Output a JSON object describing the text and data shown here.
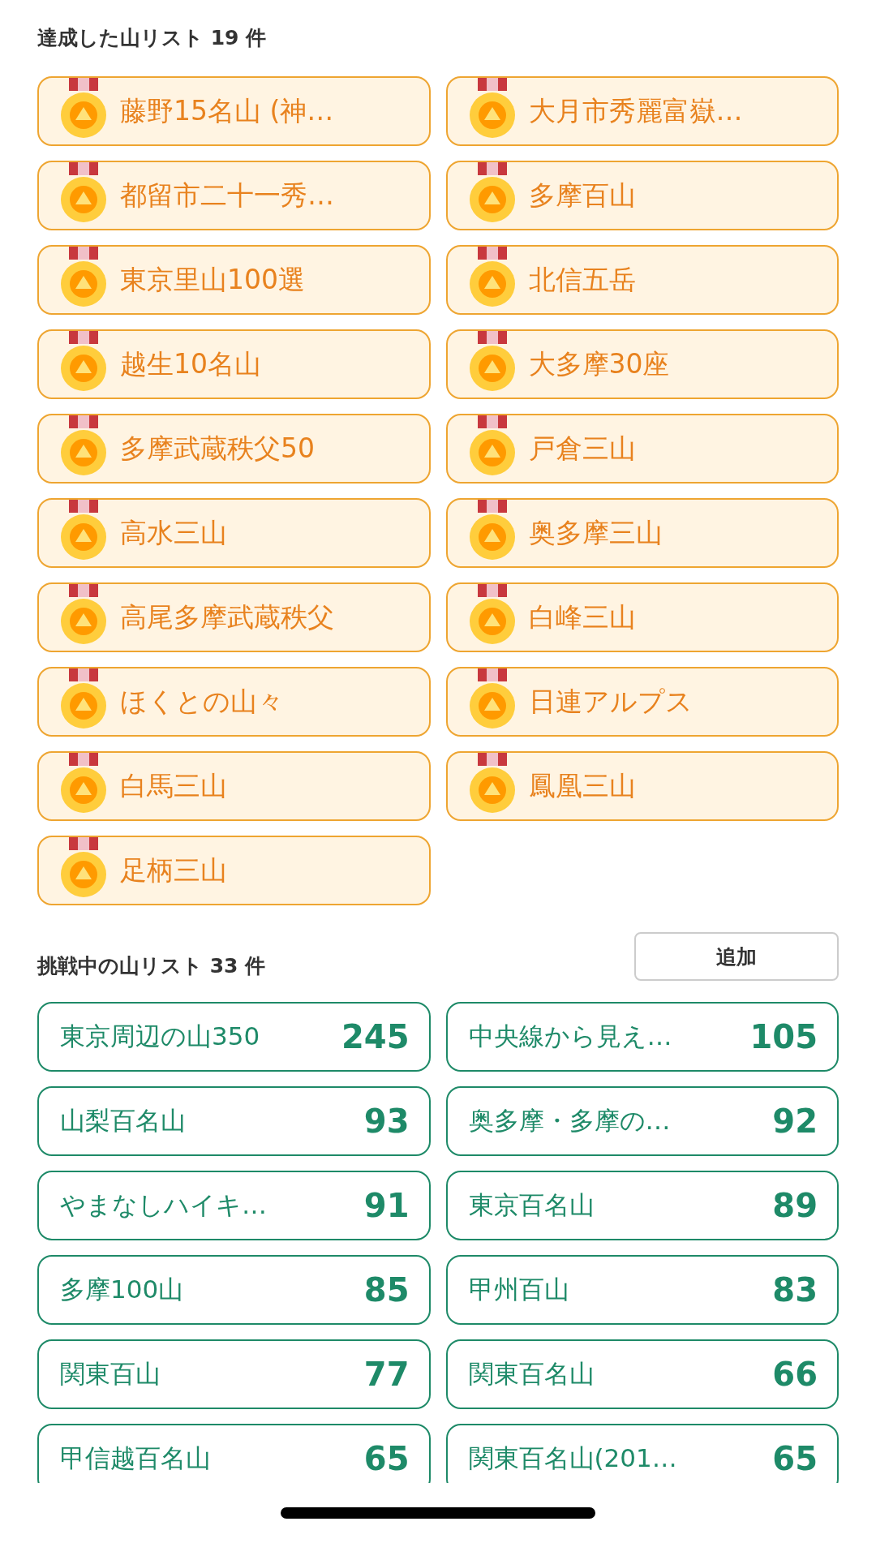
{
  "completed": {
    "title": "達成した山リスト 19 件",
    "items": [
      {
        "name": "藤野15名山 (神…"
      },
      {
        "name": "大月市秀麗富嶽…"
      },
      {
        "name": "都留市二十一秀…"
      },
      {
        "name": "多摩百山"
      },
      {
        "name": "東京里山100選"
      },
      {
        "name": "北信五岳"
      },
      {
        "name": "越生10名山"
      },
      {
        "name": "大多摩30座"
      },
      {
        "name": "多摩武蔵秩父50"
      },
      {
        "name": "戸倉三山"
      },
      {
        "name": "高水三山"
      },
      {
        "name": "奥多摩三山"
      },
      {
        "name": "高尾多摩武蔵秩父"
      },
      {
        "name": "白峰三山"
      },
      {
        "name": "ほくとの山々"
      },
      {
        "name": "日連アルプス"
      },
      {
        "name": "白馬三山"
      },
      {
        "name": "鳳凰三山"
      },
      {
        "name": "足柄三山"
      }
    ]
  },
  "challenging": {
    "title": "挑戦中の山リスト 33 件",
    "add_button": "追加",
    "items": [
      {
        "name": "東京周辺の山350",
        "count": "245"
      },
      {
        "name": "中央線から見え…",
        "count": "105"
      },
      {
        "name": "山梨百名山",
        "count": "93"
      },
      {
        "name": "奥多摩・多摩の…",
        "count": "92"
      },
      {
        "name": "やまなしハイキ…",
        "count": "91"
      },
      {
        "name": "東京百名山",
        "count": "89"
      },
      {
        "name": "多摩100山",
        "count": "85"
      },
      {
        "name": "甲州百山",
        "count": "83"
      },
      {
        "name": "関東百山",
        "count": "77"
      },
      {
        "name": "関東百名山",
        "count": "66"
      },
      {
        "name": "甲信越百名山",
        "count": "65"
      },
      {
        "name": "関東百名山(201…",
        "count": "65"
      }
    ]
  }
}
